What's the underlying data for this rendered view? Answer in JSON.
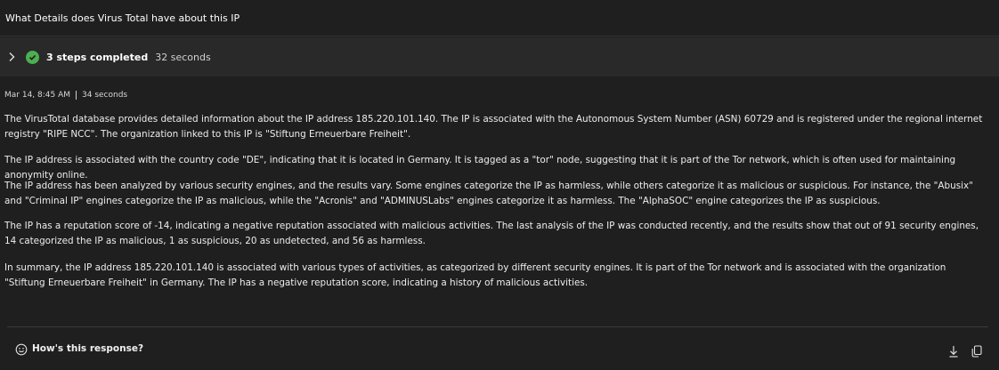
{
  "prompt": {
    "text": "What Details does Virus Total have about this IP"
  },
  "steps": {
    "title": "3 steps completed",
    "duration": "32 seconds",
    "icons": {
      "expand": "chevron-right-icon",
      "status": "check-circle-icon"
    },
    "status_color": "#4caf50"
  },
  "response": {
    "date": "Mar 14, 8:45 AM",
    "elapsed": "34 seconds",
    "paragraphs": [
      "The VirusTotal database provides detailed information about the IP address 185.220.101.140. The IP is associated with the Autonomous System Number (ASN) 60729 and is registered under the regional internet registry \"RIPE NCC\". The organization linked to this IP is \"Stiftung Erneuerbare Freiheit\".",
      "The IP address is associated with the country code \"DE\", indicating that it is located in Germany. It is tagged as a \"tor\" node, suggesting that it is part of the Tor network, which is often used for maintaining anonymity online.",
      "The IP address has been analyzed by various security engines, and the results vary. Some engines categorize the IP as harmless, while others categorize it as malicious or suspicious. For instance, the \"Abusix\" and \"Criminal IP\" engines categorize the IP as malicious, while the \"Acronis\" and \"ADMINUSLabs\" engines categorize it as harmless. The \"AlphaSOC\" engine categorizes the IP as suspicious.",
      "The IP has a reputation score of -14, indicating a negative reputation associated with malicious activities. The last analysis of the IP was conducted recently, and the results show that out of 91 security engines, 14 categorized the IP as malicious, 1 as suspicious, 20 as undetected, and 56 as harmless.",
      "In summary, the IP address 185.220.101.140 is associated with various types of activities, as categorized by different security engines. It is part of the Tor network and is associated with the organization \"Stiftung Erneuerbare Freiheit\" in Germany. The IP has a negative reputation score, indicating a history of malicious activities."
    ]
  },
  "feedback": {
    "label": "How's this response?",
    "icons": {
      "feedback": "smile-icon",
      "download": "download-icon",
      "copy": "copy-icon"
    }
  }
}
